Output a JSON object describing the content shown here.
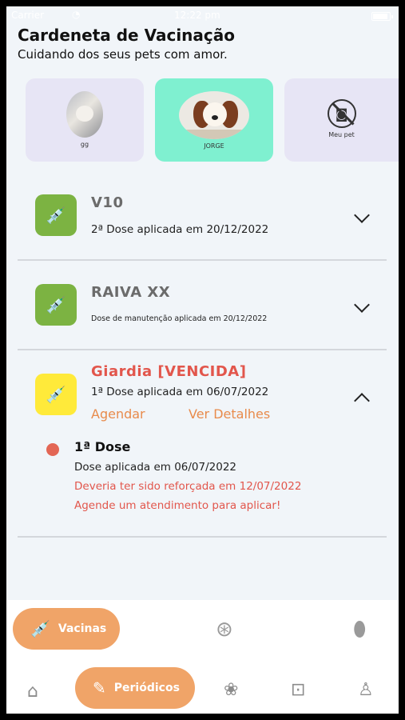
{
  "status_bar": {
    "carrier": "Carrier",
    "time": "12:22 pm"
  },
  "header": {
    "title": "Cardeneta de Vacinação",
    "subtitle": "Cuidando dos seus pets com amor."
  },
  "pets": [
    {
      "name": "gg"
    },
    {
      "name": "JORGE"
    },
    {
      "name": "Meu pet"
    }
  ],
  "vaccines": [
    {
      "name": "V10",
      "status": "2ª Dose aplicada em 20/12/2022",
      "icon": "syringe-vial-icon"
    },
    {
      "name": "RAIVA XX",
      "status": "Dose de manutenção aplicada em 20/12/2022",
      "icon": "syringe-vial-icon"
    },
    {
      "name": "Giardia [VENCIDA]",
      "status": "1ª Dose aplicada em 06/07/2022",
      "icon": "syringe-vial-icon",
      "actions": {
        "schedule": "Agendar",
        "details": "Ver Detalhes"
      },
      "dose": {
        "title": "1ª Dose",
        "applied": "Dose aplicada em 06/07/2022",
        "warning": "Deveria ter sido reforçada em 12/07/2022",
        "cta": "Agende um atendimento para aplicar!"
      }
    }
  ],
  "bottom_menu": {
    "vaccines_label": "Vacinas",
    "periodic_label": "Periódicos"
  },
  "colors": {
    "accent": "#f0a468",
    "selected_pet": "#7ff0d0",
    "overdue": "#e2564c",
    "green_badge": "#7cb342",
    "yellow_badge": "#ffea3a"
  }
}
